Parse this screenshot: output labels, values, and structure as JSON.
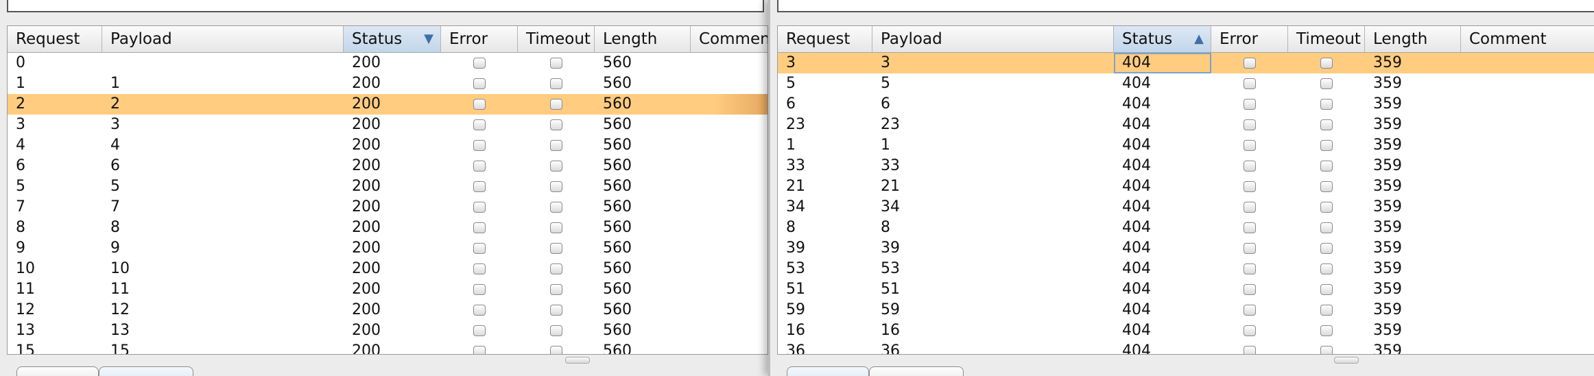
{
  "columns": [
    "Request",
    "Payload",
    "Status",
    "Error",
    "Timeout",
    "Length",
    "Comment"
  ],
  "left": {
    "sort": {
      "column": "Status",
      "direction": "descending",
      "arrow": "▼"
    },
    "selected_index": 2,
    "rows": [
      {
        "request": "0",
        "payload": "",
        "status": "200",
        "error": false,
        "timeout": false,
        "length": "560"
      },
      {
        "request": "1",
        "payload": "1",
        "status": "200",
        "error": false,
        "timeout": false,
        "length": "560"
      },
      {
        "request": "2",
        "payload": "2",
        "status": "200",
        "error": false,
        "timeout": false,
        "length": "560"
      },
      {
        "request": "3",
        "payload": "3",
        "status": "200",
        "error": false,
        "timeout": false,
        "length": "560"
      },
      {
        "request": "4",
        "payload": "4",
        "status": "200",
        "error": false,
        "timeout": false,
        "length": "560"
      },
      {
        "request": "6",
        "payload": "6",
        "status": "200",
        "error": false,
        "timeout": false,
        "length": "560"
      },
      {
        "request": "5",
        "payload": "5",
        "status": "200",
        "error": false,
        "timeout": false,
        "length": "560"
      },
      {
        "request": "7",
        "payload": "7",
        "status": "200",
        "error": false,
        "timeout": false,
        "length": "560"
      },
      {
        "request": "8",
        "payload": "8",
        "status": "200",
        "error": false,
        "timeout": false,
        "length": "560"
      },
      {
        "request": "9",
        "payload": "9",
        "status": "200",
        "error": false,
        "timeout": false,
        "length": "560"
      },
      {
        "request": "10",
        "payload": "10",
        "status": "200",
        "error": false,
        "timeout": false,
        "length": "560"
      },
      {
        "request": "11",
        "payload": "11",
        "status": "200",
        "error": false,
        "timeout": false,
        "length": "560"
      },
      {
        "request": "12",
        "payload": "12",
        "status": "200",
        "error": false,
        "timeout": false,
        "length": "560"
      },
      {
        "request": "13",
        "payload": "13",
        "status": "200",
        "error": false,
        "timeout": false,
        "length": "560"
      },
      {
        "request": "15",
        "payload": "15",
        "status": "200",
        "error": false,
        "timeout": false,
        "length": "560"
      }
    ]
  },
  "right": {
    "sort": {
      "column": "Status",
      "direction": "ascending",
      "arrow": "▲"
    },
    "selected_index": 0,
    "rows": [
      {
        "request": "3",
        "payload": "3",
        "status": "404",
        "error": false,
        "timeout": false,
        "length": "359"
      },
      {
        "request": "5",
        "payload": "5",
        "status": "404",
        "error": false,
        "timeout": false,
        "length": "359"
      },
      {
        "request": "6",
        "payload": "6",
        "status": "404",
        "error": false,
        "timeout": false,
        "length": "359"
      },
      {
        "request": "23",
        "payload": "23",
        "status": "404",
        "error": false,
        "timeout": false,
        "length": "359"
      },
      {
        "request": "1",
        "payload": "1",
        "status": "404",
        "error": false,
        "timeout": false,
        "length": "359"
      },
      {
        "request": "33",
        "payload": "33",
        "status": "404",
        "error": false,
        "timeout": false,
        "length": "359"
      },
      {
        "request": "21",
        "payload": "21",
        "status": "404",
        "error": false,
        "timeout": false,
        "length": "359"
      },
      {
        "request": "34",
        "payload": "34",
        "status": "404",
        "error": false,
        "timeout": false,
        "length": "359"
      },
      {
        "request": "8",
        "payload": "8",
        "status": "404",
        "error": false,
        "timeout": false,
        "length": "359"
      },
      {
        "request": "39",
        "payload": "39",
        "status": "404",
        "error": false,
        "timeout": false,
        "length": "359"
      },
      {
        "request": "53",
        "payload": "53",
        "status": "404",
        "error": false,
        "timeout": false,
        "length": "359"
      },
      {
        "request": "51",
        "payload": "51",
        "status": "404",
        "error": false,
        "timeout": false,
        "length": "359"
      },
      {
        "request": "59",
        "payload": "59",
        "status": "404",
        "error": false,
        "timeout": false,
        "length": "359"
      },
      {
        "request": "16",
        "payload": "16",
        "status": "404",
        "error": false,
        "timeout": false,
        "length": "359"
      },
      {
        "request": "36",
        "payload": "36",
        "status": "404",
        "error": false,
        "timeout": false,
        "length": "359"
      }
    ]
  },
  "colors": {
    "selected_row": "#ffcc80",
    "sorted_header": "#c3d6ea",
    "sort_arrow": "#3f6fa8"
  },
  "icons": {
    "sort_desc": "sort-descending-icon",
    "sort_asc": "sort-ascending-icon"
  }
}
